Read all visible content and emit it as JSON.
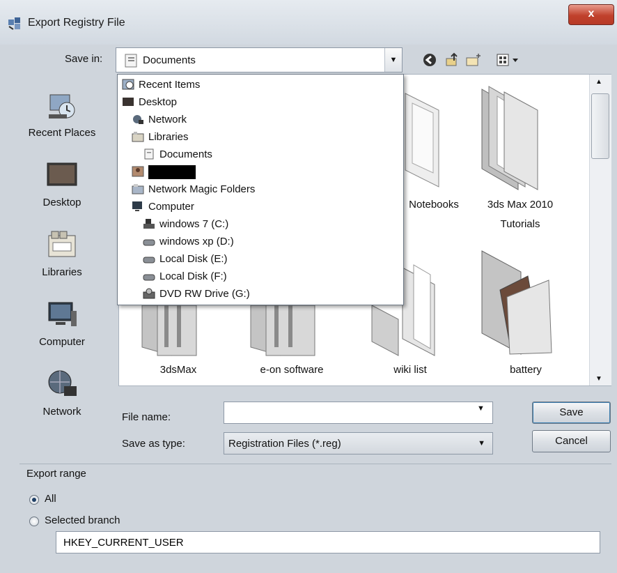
{
  "window": {
    "title": "Export Registry File",
    "close_glyph": "x"
  },
  "toolbar": {
    "save_in_label": "Save in:",
    "save_in_value": "Documents",
    "icons": [
      "back-icon",
      "up-folder-icon",
      "new-folder-icon",
      "view-menu-icon"
    ]
  },
  "places": [
    {
      "label": "Recent Places",
      "icon": "recent-places-icon"
    },
    {
      "label": "Desktop",
      "icon": "desktop-icon"
    },
    {
      "label": "Libraries",
      "icon": "libraries-icon"
    },
    {
      "label": "Computer",
      "icon": "computer-icon"
    },
    {
      "label": "Network",
      "icon": "network-icon"
    }
  ],
  "dropdown": {
    "items": [
      {
        "label": "Recent Items",
        "icon": "recent-items-icon"
      },
      {
        "label": "Desktop",
        "icon": "desktop-icon"
      },
      {
        "label": "Network",
        "icon": "network-icon"
      },
      {
        "label": "Libraries",
        "icon": "libraries-icon"
      },
      {
        "label": "Documents",
        "icon": "documents-icon"
      },
      {
        "label": "",
        "icon": "user-icon"
      },
      {
        "label": "Network Magic Folders",
        "icon": "network-folders-icon"
      },
      {
        "label": "Computer",
        "icon": "computer-icon"
      },
      {
        "label": "windows 7 (C:)",
        "icon": "system-drive-icon"
      },
      {
        "label": "windows xp (D:)",
        "icon": "drive-icon"
      },
      {
        "label": "Local Disk (E:)",
        "icon": "drive-icon"
      },
      {
        "label": "Local Disk (F:)",
        "icon": "drive-icon"
      },
      {
        "label": "DVD RW Drive (G:)",
        "icon": "dvd-drive-icon"
      }
    ]
  },
  "files": {
    "folders": [
      {
        "label": "Notebooks"
      },
      {
        "label": "3ds Max 2010",
        "label2": "Tutorials"
      },
      {
        "label": "3dsMax"
      },
      {
        "label": "e-on software"
      },
      {
        "label": "wiki list"
      },
      {
        "label": "battery"
      }
    ]
  },
  "form": {
    "file_name_label": "File name:",
    "file_name_value": "",
    "save_as_type_label": "Save as type:",
    "save_as_type_value": "Registration Files (*.reg)",
    "save_button": "Save",
    "cancel_button": "Cancel"
  },
  "export_range": {
    "label": "Export range",
    "all_label": "All",
    "selected_branch_label": "Selected branch",
    "branch_value": "HKEY_CURRENT_USER",
    "selected": "All"
  },
  "colors": {
    "accent": "#3c7fb1",
    "close_button": "#c0412c",
    "background": "#cfd5dc"
  }
}
